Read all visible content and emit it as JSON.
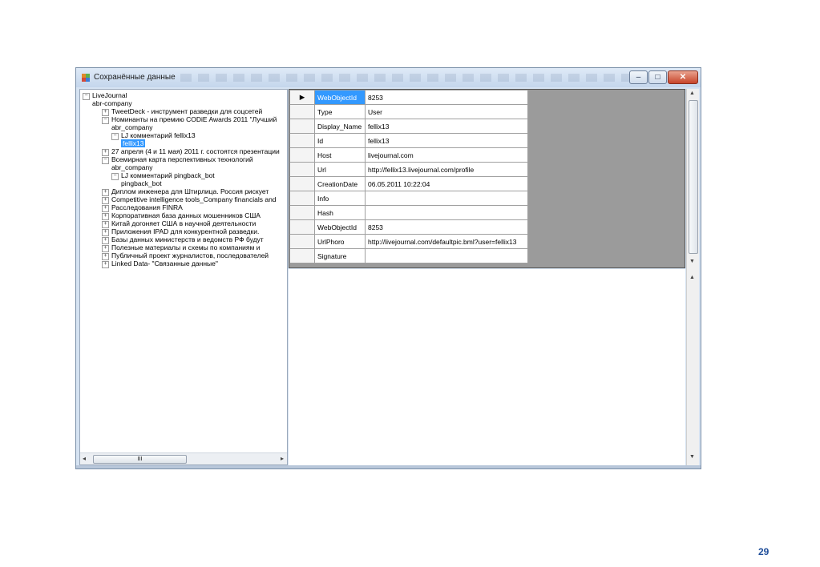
{
  "window": {
    "title": "Сохранённые данные",
    "minimize_label": "–",
    "maximize_label": "□",
    "close_label": "✕"
  },
  "tree": {
    "items": [
      {
        "label": "LiveJournal",
        "level": 0,
        "expander": "−"
      },
      {
        "label": "abr-company",
        "level": 1,
        "expander": ""
      },
      {
        "label": "TweetDeck - инструмент разведки для соцсетей",
        "level": 2,
        "expander": "+"
      },
      {
        "label": "Номинанты на премию CODiE Awards 2011 \"Лучший",
        "level": 2,
        "expander": "−"
      },
      {
        "label": "abr_company",
        "level": 3,
        "expander": ""
      },
      {
        "label": "LJ комментарий fellix13",
        "level": 3,
        "expander": "−"
      },
      {
        "label": "fellix13",
        "level": 4,
        "expander": "",
        "selected": true
      },
      {
        "label": "27 апреля (4 и 11 мая) 2011 г. состоятся презентации",
        "level": 2,
        "expander": "+"
      },
      {
        "label": "Всемирная карта перспективных технологий",
        "level": 2,
        "expander": "−"
      },
      {
        "label": "abr_company",
        "level": 3,
        "expander": ""
      },
      {
        "label": "LJ комментарий pingback_bot",
        "level": 3,
        "expander": "−"
      },
      {
        "label": "pingback_bot",
        "level": 4,
        "expander": ""
      },
      {
        "label": "Диплом инженера для Штирлица. Россия рискует",
        "level": 2,
        "expander": "+"
      },
      {
        "label": "Competitive intelligence tools_Company financials and",
        "level": 2,
        "expander": "+"
      },
      {
        "label": "Расследования FINRA",
        "level": 2,
        "expander": "+"
      },
      {
        "label": "Корпоративная база данных мошенников США",
        "level": 2,
        "expander": "+"
      },
      {
        "label": "Китай догоняет США в научной деятельности",
        "level": 2,
        "expander": "+"
      },
      {
        "label": "Приложения IPAD для конкурентной разведки.",
        "level": 2,
        "expander": "+"
      },
      {
        "label": "Базы данных министерств и ведомств РФ будут",
        "level": 2,
        "expander": "+"
      },
      {
        "label": "Полезные материалы и схемы по компаниям и",
        "level": 2,
        "expander": "+"
      },
      {
        "label": "Публичный проект журналистов, последователей",
        "level": 2,
        "expander": "+"
      },
      {
        "label": "Linked Data- \"Связанные данные\"",
        "level": 2,
        "expander": "+"
      }
    ],
    "hscroll_thumb_label": "III"
  },
  "grid": {
    "rows": [
      {
        "key": "WebObjectId",
        "value": "8253",
        "current": true
      },
      {
        "key": "Type",
        "value": "User"
      },
      {
        "key": "Display_Name",
        "value": "fellix13"
      },
      {
        "key": "Id",
        "value": "fellix13"
      },
      {
        "key": "Host",
        "value": "livejournal.com"
      },
      {
        "key": "Url",
        "value": "http://fellix13.livejournal.com/profile"
      },
      {
        "key": "CreationDate",
        "value": "06.05.2011 10:22:04"
      },
      {
        "key": "Info",
        "value": ""
      },
      {
        "key": "Hash",
        "value": ""
      },
      {
        "key": "WebObjectId",
        "value": "8253"
      },
      {
        "key": "UrlPhoro",
        "value": "http://livejournal.com/defaultpic.bml?user=fellix13"
      },
      {
        "key": "Signature",
        "value": ""
      }
    ],
    "current_row_marker": "▶"
  },
  "page_number": "29",
  "colors": {
    "selection": "#3399ff",
    "page_number": "#1f4e9a"
  }
}
